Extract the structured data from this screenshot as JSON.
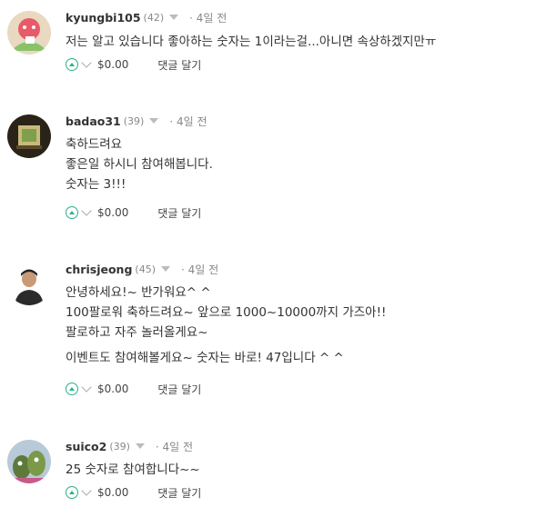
{
  "comments": [
    {
      "username": "kyungbi105",
      "reputation": "(42)",
      "time": "· 4일 전",
      "lines": [
        "저는 알고 있습니다 좋아하는 숫자는 1이라는걸...아니면 속상하겠지만ㅠ"
      ],
      "payout": "$0.00",
      "reply_label": "댓글 달기"
    },
    {
      "username": "badao31",
      "reputation": "(39)",
      "time": "· 4일 전",
      "lines": [
        "축하드려요",
        "좋은일 하시니 참여해봅니다.",
        "숫자는 3!!!"
      ],
      "payout": "$0.00",
      "reply_label": "댓글 달기"
    },
    {
      "username": "chrisjeong",
      "reputation": "(45)",
      "time": "· 4일 전",
      "lines": [
        "안녕하세요!~ 반가워요^ ^",
        "100팔로워 축하드려요~ 앞으로 1000~10000까지 가즈아!!",
        "팔로하고 자주 놀러올게요~"
      ],
      "lines2": [
        "이벤트도 참여해볼게요~ 숫자는 바로! 47입니다 ^ ^"
      ],
      "payout": "$0.00",
      "reply_label": "댓글 달기"
    },
    {
      "username": "suico2",
      "reputation": "(39)",
      "time": "· 4일 전",
      "lines": [
        "25 숫자로 참여합니다~~"
      ],
      "payout": "$0.00",
      "reply_label": "댓글 달기"
    }
  ]
}
